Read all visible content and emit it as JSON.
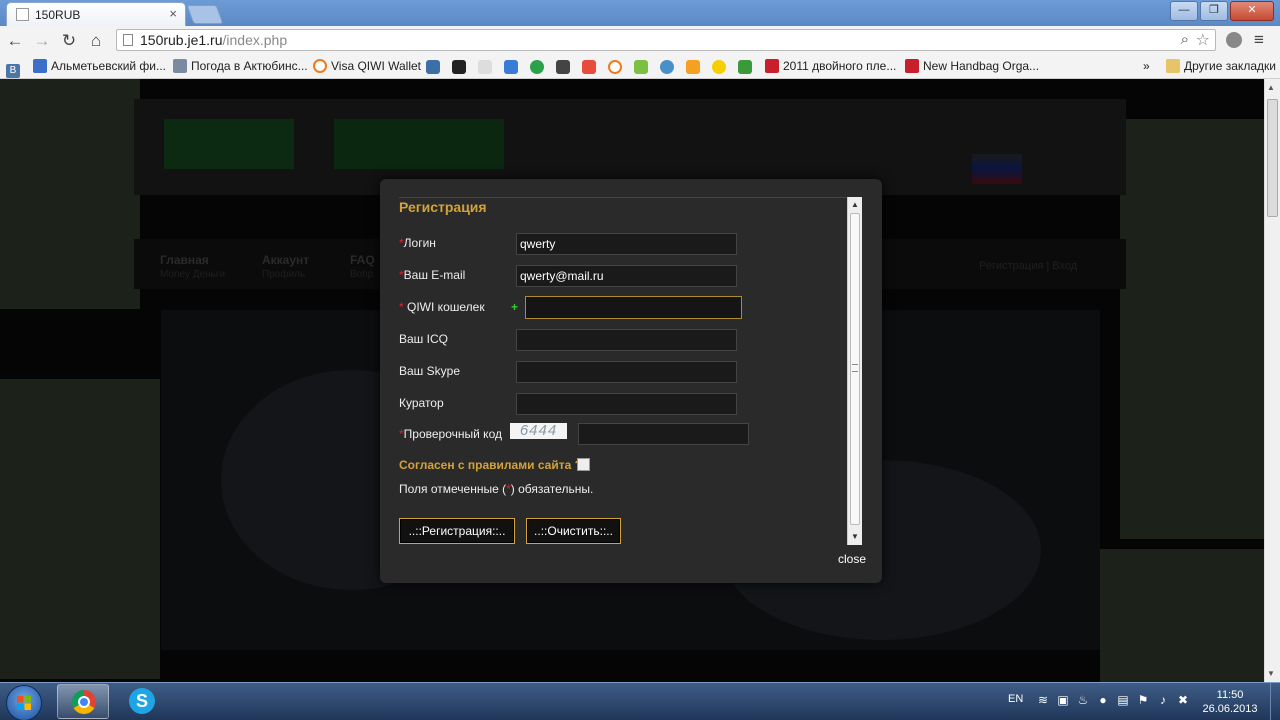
{
  "browser": {
    "tab_title": "150RUB",
    "tab_close": "×",
    "url_host": "150rub.je1.ru",
    "url_path": "/index.php",
    "window_buttons": {
      "minimize": "—",
      "maximize": "❐",
      "close": "✕"
    }
  },
  "bookmarks": {
    "items": [
      {
        "label": "В",
        "icon": "vk-icon",
        "color": "#4a76a8"
      },
      {
        "label": "Альметьевский фи...",
        "icon": "bookmark-star-icon",
        "color": "#3a6ec8"
      },
      {
        "label": "Погода в Актюбинс...",
        "icon": "weather-icon",
        "color": "#7a8aa0"
      },
      {
        "label": "Visa QIWI Wallet",
        "icon": "qiwi-icon",
        "color": "#f07a1e"
      },
      {
        "label": "2011 двойного пле...",
        "icon": "shop-icon",
        "color": "#c8202a"
      },
      {
        "label": "New Handbag Orga...",
        "icon": "shop-icon",
        "color": "#c8202a"
      }
    ],
    "overflow": "»",
    "other_label": "Другие закладки"
  },
  "site": {
    "nav": [
      {
        "title": "Главная",
        "subtitle": "Money Деньги"
      },
      {
        "title": "Аккаунт",
        "subtitle": "Профиль"
      },
      {
        "title": "FAQ",
        "subtitle": "Вопр"
      }
    ],
    "nav_right": "Регистрация | Вход"
  },
  "modal": {
    "title": "Регистрация",
    "fields": {
      "login": {
        "label": "Логин",
        "value": "qwerty"
      },
      "email": {
        "label": "Ваш E-mail",
        "value": "qwerty@mail.ru"
      },
      "qiwi": {
        "label": "QIWI кошелек",
        "prefix": "+",
        "value": ""
      },
      "icq": {
        "label": "Ваш ICQ",
        "value": ""
      },
      "skype": {
        "label": "Ваш Skype",
        "value": ""
      },
      "curator": {
        "label": "Куратор",
        "value": ""
      },
      "captcha": {
        "label": "Проверочный код",
        "code": "6444",
        "value": ""
      }
    },
    "required_mark": "*",
    "agree_label": "Согласен с правилами сайта ?",
    "agree_checked": false,
    "note_prefix": "Поля отмеченные (",
    "note_suffix": ") обязательны.",
    "register_button": "..::Регистрация::..",
    "clear_button": "..::Очистить::..",
    "close_link": "close"
  },
  "taskbar": {
    "lang": "EN",
    "time": "11:50",
    "date": "26.06.2013"
  },
  "colors": {
    "accent_gold": "#d4a23a",
    "required_red": "#d23",
    "modal_bg": "#2a2a2a"
  }
}
